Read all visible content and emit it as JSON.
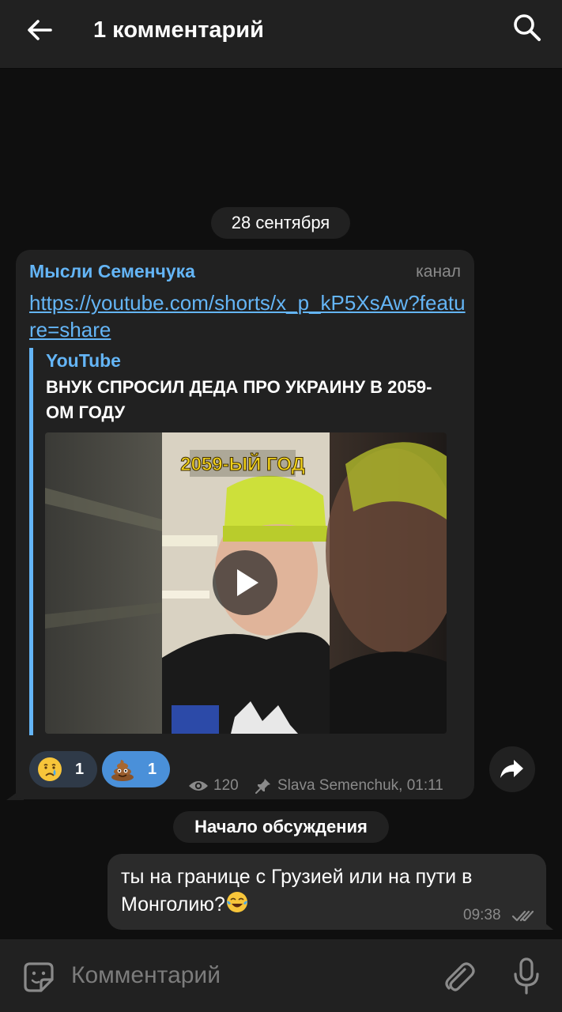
{
  "header": {
    "title": "1 комментарий",
    "back_icon": "arrow-left-icon",
    "search_icon": "search-icon"
  },
  "date_separator": "28 сентября",
  "post": {
    "channel_name": "Мысли Семенчука",
    "channel_tag": "канал",
    "link": "https://youtube.com/shorts/x_p_kP5XsAw?feature=share",
    "preview": {
      "site": "YouTube",
      "title": "ВНУК СПРОСИЛ ДЕДА ПРО УКРАИНУ В 2059-ОМ ГОДУ",
      "thumbnail_caption": "2059-ЫЙ ГОД"
    },
    "reactions": [
      {
        "emoji": "crying-face-icon",
        "count": "1"
      },
      {
        "emoji": "pile-of-poo-icon",
        "count": "1"
      }
    ],
    "views": "120",
    "author_time": "Slava Semenchuk, 01:11"
  },
  "discussion_start": "Начало обсуждения",
  "my_message": {
    "text": "ты на границе с Грузией или на пути в Монголию?",
    "emoji": "face-with-tears-of-joy-icon",
    "time": "09:38"
  },
  "composer": {
    "placeholder": "Комментарий"
  },
  "colors": {
    "background": "#0f0f0f",
    "bar": "#212121",
    "accent": "#64b5f6",
    "reaction_selected": "#4a90d9"
  }
}
